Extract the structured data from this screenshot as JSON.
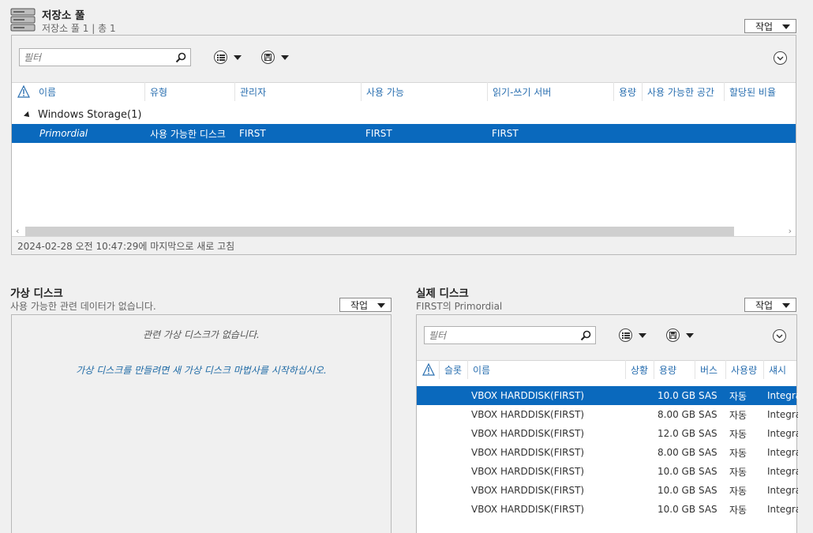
{
  "storage_pools": {
    "title": "저장소 풀",
    "subtitle": "저장소 풀 1 | 총 1",
    "tasks_label": "작업",
    "filter_placeholder": "필터",
    "columns": [
      "이름",
      "유형",
      "관리자",
      "사용 가능",
      "읽기-쓰기 서버",
      "용량",
      "사용 가능한 공간",
      "할당된 비율"
    ],
    "group_label": "Windows Storage(1)",
    "rows": [
      {
        "name": "Primordial",
        "type": "사용 가능한 디스크",
        "manager": "FIRST",
        "available": "FIRST",
        "rw_server": "FIRST",
        "capacity": "",
        "free_space": "",
        "allocated": ""
      }
    ],
    "status": "2024-02-28 오전 10:47:29에 마지막으로 새로 고침"
  },
  "virtual_disks": {
    "title": "가상 디스크",
    "subtitle": "사용 가능한 관련 데이터가 없습니다.",
    "tasks_label": "작업",
    "empty_message": "관련 가상 디스크가 없습니다.",
    "hint_message": "가상 디스크를 만들려면 새 가상 디스크 마법사를 시작하십시오."
  },
  "physical_disks": {
    "title": "실제 디스크",
    "subtitle": "FIRST의 Primordial",
    "tasks_label": "작업",
    "filter_placeholder": "필터",
    "columns": [
      "슬롯",
      "이름",
      "상황",
      "용량",
      "버스",
      "사용량",
      "섀시"
    ],
    "rows": [
      {
        "slot": "",
        "name": "VBOX HARDDISK(FIRST)",
        "status": "",
        "capacity": "10.0 GB",
        "bus": "SAS",
        "usage": "자동",
        "chassis": "Integra"
      },
      {
        "slot": "",
        "name": "VBOX HARDDISK(FIRST)",
        "status": "",
        "capacity": "8.00 GB",
        "bus": "SAS",
        "usage": "자동",
        "chassis": "Integra"
      },
      {
        "slot": "",
        "name": "VBOX HARDDISK(FIRST)",
        "status": "",
        "capacity": "12.0 GB",
        "bus": "SAS",
        "usage": "자동",
        "chassis": "Integra"
      },
      {
        "slot": "",
        "name": "VBOX HARDDISK(FIRST)",
        "status": "",
        "capacity": "8.00 GB",
        "bus": "SAS",
        "usage": "자동",
        "chassis": "Integra"
      },
      {
        "slot": "",
        "name": "VBOX HARDDISK(FIRST)",
        "status": "",
        "capacity": "10.0 GB",
        "bus": "SAS",
        "usage": "자동",
        "chassis": "Integra"
      },
      {
        "slot": "",
        "name": "VBOX HARDDISK(FIRST)",
        "status": "",
        "capacity": "10.0 GB",
        "bus": "SAS",
        "usage": "자동",
        "chassis": "Integra"
      },
      {
        "slot": "",
        "name": "VBOX HARDDISK(FIRST)",
        "status": "",
        "capacity": "10.0 GB",
        "bus": "SAS",
        "usage": "자동",
        "chassis": "Integra"
      }
    ]
  },
  "colors": {
    "accent": "#0a69bd",
    "header_text": "#2a6fb0",
    "link_text": "#1f6aa5"
  }
}
